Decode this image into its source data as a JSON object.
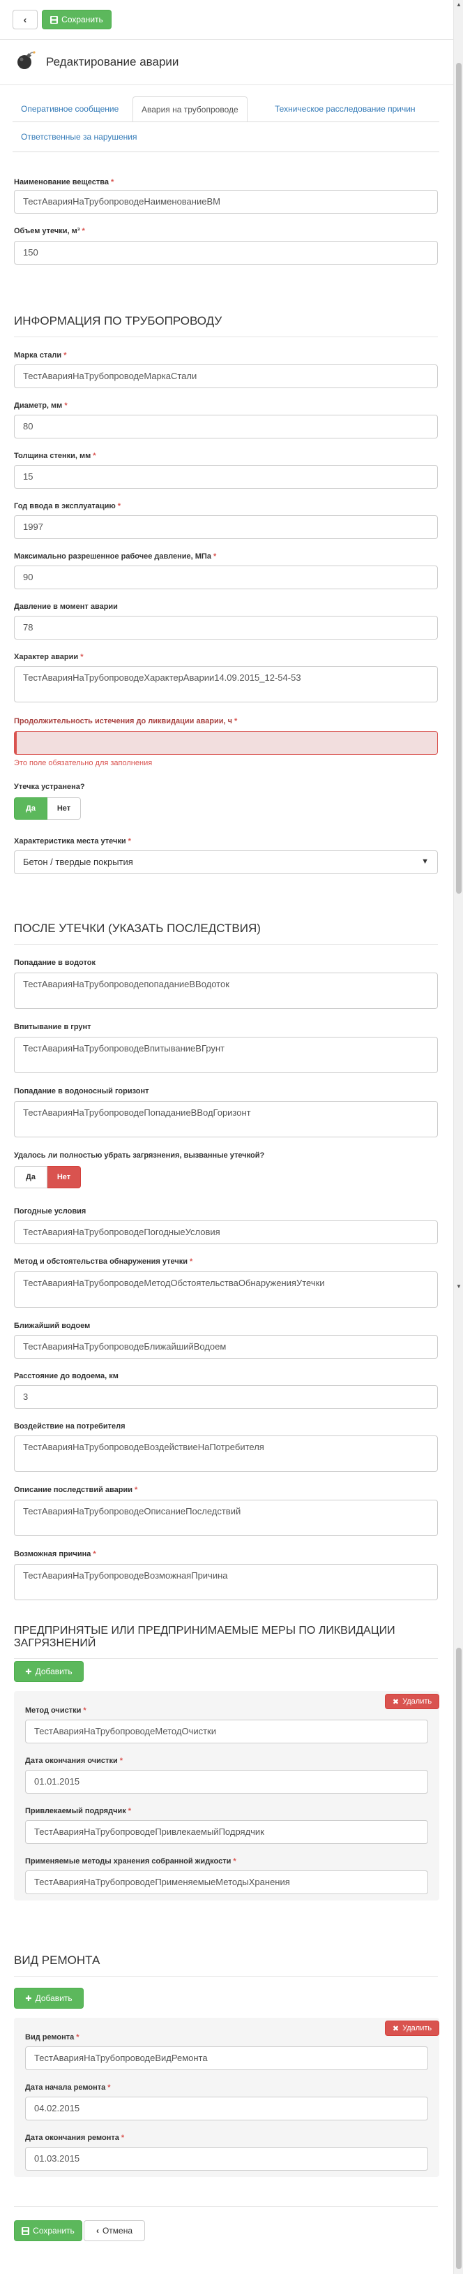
{
  "toolbar": {
    "back_icon": "chevron-left-icon",
    "save_label": "Сохранить"
  },
  "header": {
    "title": "Редактирование аварии",
    "icon": "bomb-icon"
  },
  "tabs": [
    {
      "label": "Оперативное сообщение",
      "active": false
    },
    {
      "label": "Авария на трубопроводе",
      "active": true
    },
    {
      "label": "Техническое расследование причин",
      "active": false
    },
    {
      "label": "Ответственные за нарушения",
      "active": false
    }
  ],
  "form": {
    "substance": {
      "label": "Наименование вещества",
      "value": "ТестАварияНаТрубопроводеНаименованиеВМ"
    },
    "leak_volume": {
      "label": "Объем утечки, м³",
      "value": "150"
    },
    "pipeline_title": "ИНФОРМАЦИЯ ПО ТРУБОПРОВОДУ",
    "steel": {
      "label": "Марка стали",
      "value": "ТестАварияНаТрубопроводеМаркаСтали"
    },
    "diameter": {
      "label": "Диаметр, мм",
      "value": "80"
    },
    "wall": {
      "label": "Толщина стенки, мм",
      "value": "15"
    },
    "year": {
      "label": "Год ввода в эксплуатацию",
      "value": "1997"
    },
    "max_pressure": {
      "label": "Максимально разрешенное рабочее давление, МПа",
      "value": "90"
    },
    "pressure": {
      "label": "Давление в момент аварии",
      "value": "78"
    },
    "character": {
      "label": "Характер аварии",
      "value": "ТестАварияНаТрубопроводеХарактерАварии14.09.2015_12-54-53"
    },
    "duration": {
      "label": "Продолжительность истечения до ликвидации аварии, ч",
      "value": "",
      "error": "Это поле обязательно для заполнения"
    },
    "eliminated": {
      "label": "Утечка устранена?",
      "yes": "Да",
      "no": "Нет",
      "value": "Да"
    },
    "place": {
      "label": "Характеристика места утечки",
      "value": "Бетон / твердые покрытия"
    },
    "after_title": "ПОСЛЕ УТЕЧКИ (УКАЗАТЬ ПОСЛЕДСТВИЯ)",
    "water": {
      "label": "Попадание в водоток",
      "value": "ТестАварияНаТрубопроводепопаданиеВВодоток"
    },
    "ground": {
      "label": "Впитывание в грунт",
      "value": "ТестАварияНаТрубопроводеВпитываниеВГрунт"
    },
    "aquifer": {
      "label": "Попадание в водоносный горизонт",
      "value": "ТестАварияНаТрубопроводеПопаданиеВВодГоризонт"
    },
    "cleaned": {
      "label": "Удалось ли полностью убрать загрязнения, вызванные утечкой?",
      "yes": "Да",
      "no": "Нет",
      "value": "Нет"
    },
    "weather": {
      "label": "Погодные условия",
      "value": "ТестАварияНаТрубопроводеПогодныеУсловия"
    },
    "detection": {
      "label": "Метод и обстоятельства обнаружения утечки",
      "value": "ТестАварияНаТрубопроводеМетодОбстоятельстваОбнаруженияУтечки"
    },
    "nearest_water": {
      "label": "Ближайший водоем",
      "value": "ТестАварияНаТрубопроводеБлижайшийВодоем"
    },
    "distance": {
      "label": "Расстояние до водоема, км",
      "value": "3"
    },
    "consumer": {
      "label": "Воздействие на потребителя",
      "value": "ТестАварияНаТрубопроводеВоздействиеНаПотребителя"
    },
    "consequences": {
      "label": "Описание последствий аварии",
      "value": "ТестАварияНаТрубопроводеОписаниеПоследствий"
    },
    "cause": {
      "label": "Возможная причина",
      "value": "ТестАварияНаТрубопроводеВозможнаяПричина"
    },
    "measures_title": "ПРЕДПРИНЯТЫЕ ИЛИ ПРЕДПРИНИМАЕМЫЕ МЕРЫ ПО ЛИКВИДАЦИИ ЗАГРЯЗНЕНИЙ",
    "add_label": "Добавить",
    "delete_label": "Удалить",
    "measure": {
      "method": {
        "label": "Метод очистки",
        "value": "ТестАварияНаТрубопроводеМетодОчистки"
      },
      "end_date": {
        "label": "Дата окончания очистки",
        "value": "01.01.2015"
      },
      "contractor": {
        "label": "Привлекаемый подрядчик",
        "value": "ТестАварияНаТрубопроводеПривлекаемыйПодрядчик"
      },
      "storage": {
        "label": "Применяемые методы хранения собранной жидкости",
        "value": "ТестАварияНаТрубопроводеПрименяемыеМетодыХранения"
      }
    },
    "repair_title": "ВИД РЕМОНТА",
    "repair": {
      "type": {
        "label": "Вид ремонта",
        "value": "ТестАварияНаТрубопроводеВидРемонта"
      },
      "start": {
        "label": "Дата начала ремонта",
        "value": "04.02.2015"
      },
      "end": {
        "label": "Дата окончания ремонта",
        "value": "01.03.2015"
      }
    }
  },
  "footer": {
    "save_label": "Сохранить",
    "cancel_label": "Отмена"
  },
  "colors": {
    "success": "#5cb85c",
    "danger": "#d9534f",
    "link": "#337ab7"
  }
}
